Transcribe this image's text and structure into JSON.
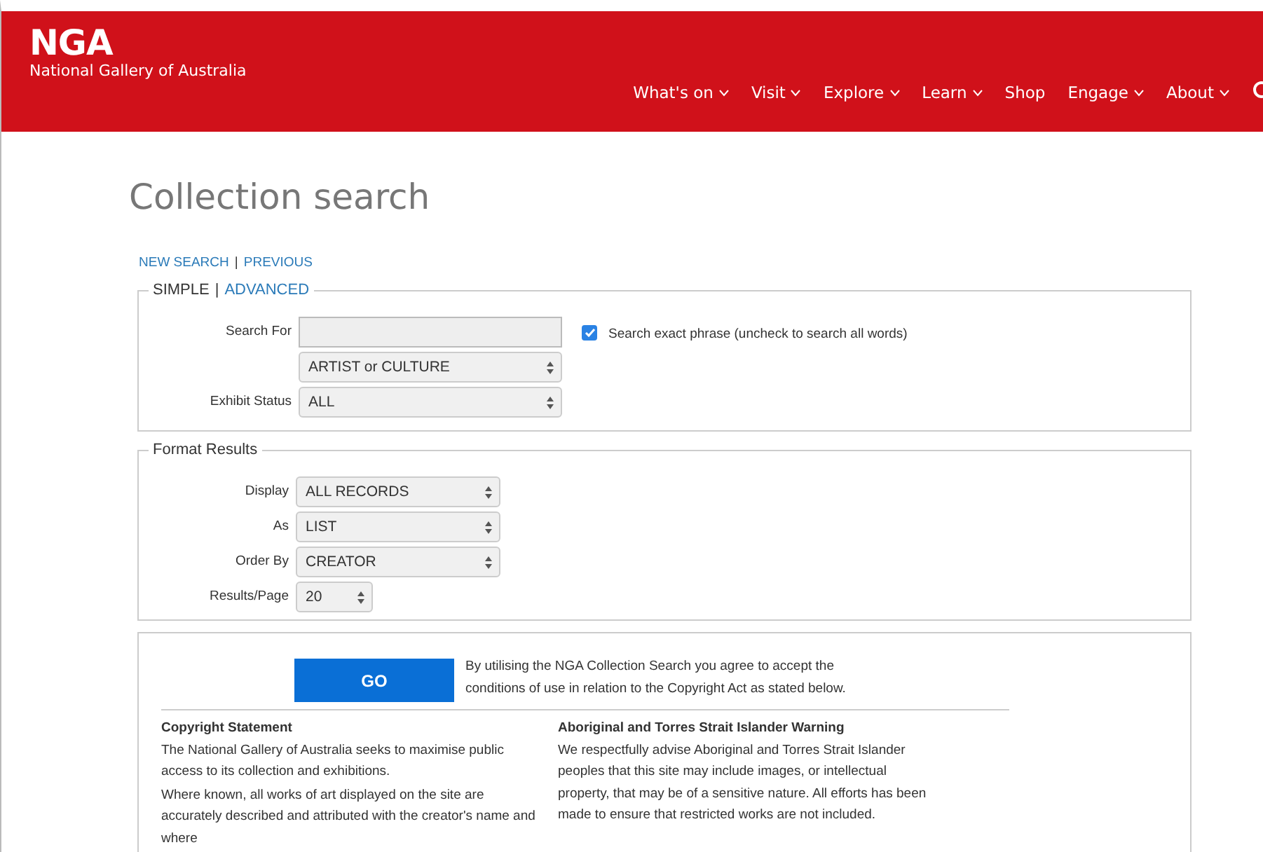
{
  "header": {
    "logo": "NGA",
    "subtitle": "National Gallery of Australia",
    "nav": [
      {
        "label": "What's on",
        "dropdown": true
      },
      {
        "label": "Visit",
        "dropdown": true
      },
      {
        "label": "Explore",
        "dropdown": true
      },
      {
        "label": "Learn",
        "dropdown": true
      },
      {
        "label": "Shop",
        "dropdown": false
      },
      {
        "label": "Engage",
        "dropdown": true
      },
      {
        "label": "About",
        "dropdown": true
      }
    ]
  },
  "page_title": "Collection search",
  "top_links": {
    "items": [
      "NEW SEARCH",
      "PREVIOUS"
    ],
    "separator": "|"
  },
  "search_panel": {
    "modes": [
      {
        "label": "SIMPLE",
        "selected": true
      },
      {
        "label": "ADVANCED",
        "selected": false
      }
    ],
    "separator": "|",
    "fields": [
      {
        "kind": "input",
        "label": "Search For"
      },
      {
        "kind": "select",
        "value": "ARTIST or CULTURE"
      },
      {
        "kind": "select",
        "label": "Exhibit Status",
        "value": "ALL"
      }
    ],
    "exact_phrase": {
      "label": "Search exact phrase (uncheck to search all words)",
      "checked": true
    }
  },
  "format_panel": {
    "legend": "Format Results",
    "fields": [
      {
        "kind": "select",
        "label": "Display",
        "value": "ALL RECORDS"
      },
      {
        "kind": "select",
        "label": "As",
        "value": "LIST"
      },
      {
        "kind": "select",
        "label": "Order By",
        "value": "CREATOR"
      },
      {
        "kind": "small-select",
        "label": "Results/Page",
        "value": "20"
      }
    ]
  },
  "go_panel": {
    "button": "GO",
    "agreement": "By utilising the NGA Collection Search you agree to accept the conditions of use in relation to the Copyright Act as stated below.",
    "sections": [
      {
        "heading": "Copyright Statement",
        "paragraphs": [
          "The National Gallery of Australia seeks to maximise public access to its collection and exhibitions.",
          "Where known, all works of art displayed on the site are accurately described and attributed with the creator's name and where"
        ]
      },
      {
        "heading": "Aboriginal and Torres Strait Islander Warning",
        "paragraphs": [
          "We respectfully advise Aboriginal and Torres Strait Islander peoples that this site may include images, or intellectual property, that may be of a sensitive nature. All efforts has been made to ensure that restricted works are not included."
        ]
      }
    ]
  }
}
